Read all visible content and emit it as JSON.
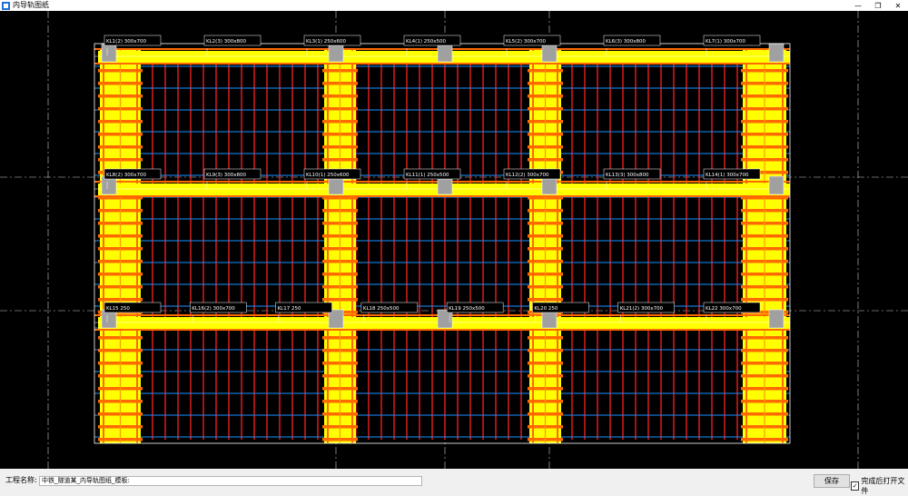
{
  "window": {
    "title": "内导轨图纸",
    "minimize_icon": "minimize-icon",
    "maximize_icon": "maximize-icon",
    "close_icon": "close-icon"
  },
  "footer": {
    "project_label": "工程名称:",
    "project_value": "中铁_隧道某_内导轨图纸_模板:",
    "save_label": "保存",
    "open_after_label": "完成后打开文件",
    "open_after_checked": true
  },
  "colors": {
    "background": "#000000",
    "tube": "#ff6a00",
    "beam": "#ffff00",
    "rod": "#ff2020",
    "cross": "#1e90ff",
    "column": "#a0a0a0"
  },
  "drawing": {
    "tags_row1": [
      "KL1(2) 300x700",
      "KL2(3) 300x800",
      "KL3(1) 250x600",
      "KL4(1) 250x500",
      "KL5(2) 300x700",
      "KL6(3) 300x800",
      "KL7(1) 300x700"
    ],
    "tags_row2": [
      "KL8(2) 300x700",
      "KL9(3) 300x800",
      "KL10(1) 250x600",
      "KL11(1) 250x500",
      "KL12(2) 300x700",
      "KL13(3) 300x800",
      "KL14(1) 300x700"
    ],
    "tags_row3": [
      "KL15 250",
      "KL16(2) 300x700",
      "KL17 250",
      "KL18 250x500",
      "KL19 250x500",
      "KL20 250",
      "KL21(2) 300x700",
      "KL22 300x700"
    ]
  }
}
